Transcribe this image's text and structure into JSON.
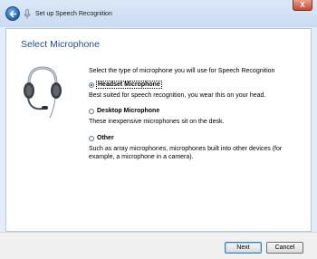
{
  "window": {
    "title": "Set up Speech Recognition",
    "close_label": "X"
  },
  "page": {
    "heading": "Select Microphone",
    "prompt": "Select the type of microphone you will use for Speech Recognition",
    "options": [
      {
        "label": "Headset Microphone",
        "desc": "Best suited for speech recognition, you wear this on your head.",
        "selected": true
      },
      {
        "label": "Desktop Microphone",
        "desc": "These inexpensive microphones sit on the desk.",
        "selected": false
      },
      {
        "label": "Other",
        "desc": "Such as array microphones, microphones built into other devices (for example, a microphone in a camera).",
        "selected": false
      }
    ]
  },
  "footer": {
    "next_label": "Next",
    "cancel_label": "Cancel"
  },
  "icons": {
    "back": "back-arrow-icon",
    "mic": "microphone-icon",
    "illustration": "headset-microphone-icon"
  }
}
